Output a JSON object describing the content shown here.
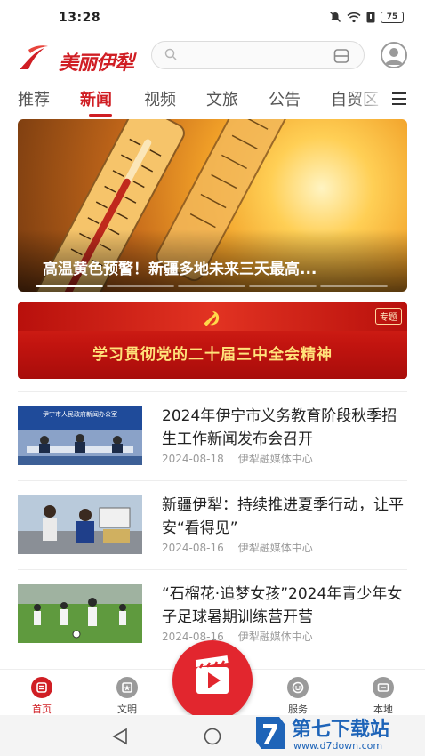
{
  "status_bar": {
    "time": "13:28",
    "battery": "75",
    "icons": [
      "mute-icon",
      "wifi-icon",
      "data-icon",
      "battery-icon"
    ]
  },
  "header": {
    "logo_text": "美丽伊犁",
    "search_placeholder": ""
  },
  "tabs": [
    {
      "label": "推荐",
      "active": false
    },
    {
      "label": "新闻",
      "active": true
    },
    {
      "label": "视频",
      "active": false
    },
    {
      "label": "文旅",
      "active": false
    },
    {
      "label": "公告",
      "active": false
    },
    {
      "label": "自贸区",
      "active": false
    }
  ],
  "hero": {
    "caption": "高温黄色预警！新疆多地未来三天最高...",
    "slide_count": 5,
    "active_slide": 1
  },
  "special_banner": {
    "title": "学习贯彻党的二十届三中全会精神",
    "tag": "专题"
  },
  "news": [
    {
      "headline": "2024年伊宁市义务教育阶段秋季招生工作新闻发布会召开",
      "date": "2024-08-18",
      "source": "伊犁融媒体中心",
      "thumb_caption": "伊宁市人民政府新闻办公室"
    },
    {
      "headline": "新疆伊犁：持续推进夏季行动，让平安“看得见”",
      "date": "2024-08-16",
      "source": "伊犁融媒体中心"
    },
    {
      "headline": "“石榴花·追梦女孩”2024年青少年女子足球暑期训练营开营",
      "date": "2024-08-16",
      "source": "伊犁融媒体中心"
    }
  ],
  "bottom_nav": [
    {
      "label": "首页",
      "icon": "home-icon",
      "active": true
    },
    {
      "label": "文明",
      "icon": "civilization-icon",
      "active": false
    },
    {
      "label": "服务",
      "icon": "service-icon",
      "active": false
    },
    {
      "label": "本地",
      "icon": "local-icon",
      "active": false
    }
  ],
  "watermark": {
    "title": "第七下载站",
    "url": "www.d7down.com"
  },
  "colors": {
    "brand_red": "#d01e24",
    "banner_gold": "#ffe27a",
    "watermark_blue": "#1e64b8"
  }
}
